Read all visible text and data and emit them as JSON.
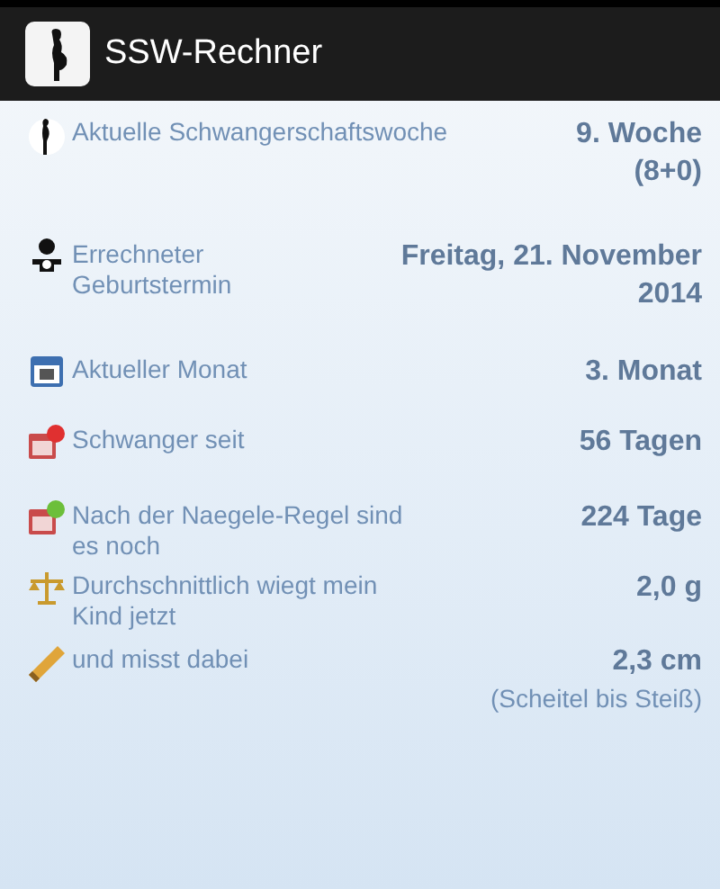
{
  "app_bar": {
    "title": "SSW-Rechner"
  },
  "rows": [
    {
      "kind": "figure",
      "label": "Aktuelle Schwangerschaftswoche",
      "value_lines": [
        "9. Woche",
        "(8+0)"
      ]
    },
    {
      "kind": "baby",
      "label": "Errechneter Geburtstermin",
      "value_lines": [
        "Freitag, 21. November",
        "2014"
      ]
    },
    {
      "kind": "calendar",
      "label": "Aktueller Monat",
      "value_lines": [
        "3. Monat"
      ]
    },
    {
      "kind": "calendar-minus",
      "label": "Schwanger seit",
      "value_lines": [
        "56 Tagen"
      ]
    },
    {
      "kind": "calendar-plus",
      "label": "Nach der Naegele-Regel sind es noch",
      "value_lines": [
        "224 Tage"
      ]
    },
    {
      "kind": "scale",
      "label": "Durchschnittlich wiegt mein Kind jetzt",
      "value_lines": [
        "2,0 g"
      ]
    },
    {
      "kind": "ruler",
      "label": "und misst dabei",
      "value_lines": [
        "2,3 cm"
      ],
      "note": "(Scheitel bis Steiß)"
    }
  ]
}
